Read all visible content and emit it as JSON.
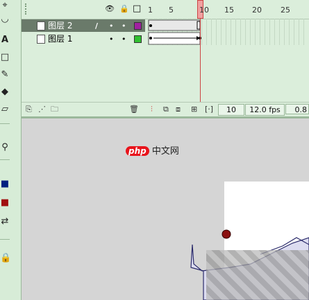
{
  "timeline": {
    "ruler": [
      "1",
      "5",
      "10",
      "15",
      "20",
      "25"
    ],
    "layers": [
      {
        "name": "图层 2",
        "selected": true,
        "pencil": "/",
        "color": "#a020a0"
      },
      {
        "name": "图层 1",
        "selected": false,
        "pencil": "",
        "color": "#30c030"
      }
    ],
    "current_frame": "10",
    "fps": "12.0 fps",
    "elapsed": "0.8"
  },
  "watermark": {
    "logo": "php",
    "text": "中文网"
  },
  "colors": {
    "panel_bg": "#dbeedb",
    "selected_row": "#6a7a6a",
    "playhead": "#f0a0a0",
    "stage_bg": "#d5d5d5"
  }
}
